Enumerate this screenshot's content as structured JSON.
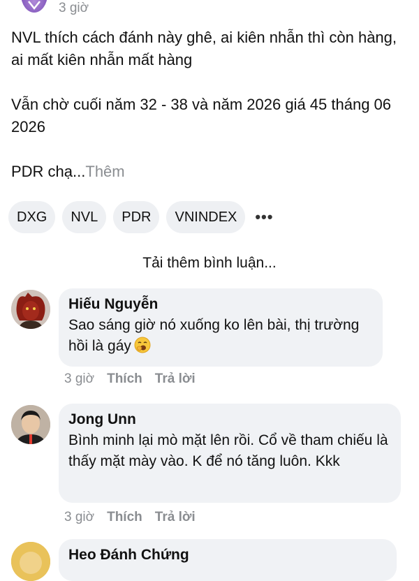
{
  "post": {
    "time": "3 giờ",
    "paragraphs": [
      "NVL thích cách đánh này ghê, ai kiên nhẫn thì còn hàng, ai mất kiên nhẫn mất hàng",
      "Vẫn chờ cuối năm 32 - 38 và năm 2026 giá 45 tháng 06 2026"
    ],
    "truncated_text": "PDR chạ...",
    "more_label": "Thêm",
    "tags": [
      "DXG",
      "NVL",
      "PDR",
      "VNINDEX"
    ],
    "more_tags_icon": "•••"
  },
  "load_more_label": "Tải thêm bình luận...",
  "comments": [
    {
      "author": "Hiếu Nguyễn",
      "text": "Sao sáng giờ nó xuống ko lên bài, thị trường hồi là gáy",
      "emoji": "yawning-face-emoji",
      "time": "3 giờ",
      "like_label": "Thích",
      "reply_label": "Trả lời"
    },
    {
      "author": "Jong Unn",
      "text": "Bình minh lại mò mặt lên rồi. Cổ về tham chiếu là thấy mặt mày vào. K để nó tăng luôn. Kkk",
      "time": "3 giờ",
      "like_label": "Thích",
      "reply_label": "Trả lời"
    },
    {
      "author": "Heo Đánh Chứng"
    }
  ],
  "colors": {
    "muted_text": "#8a8d91",
    "bubble_bg": "#f0f2f5",
    "tag_bg": "#eef0f3"
  }
}
